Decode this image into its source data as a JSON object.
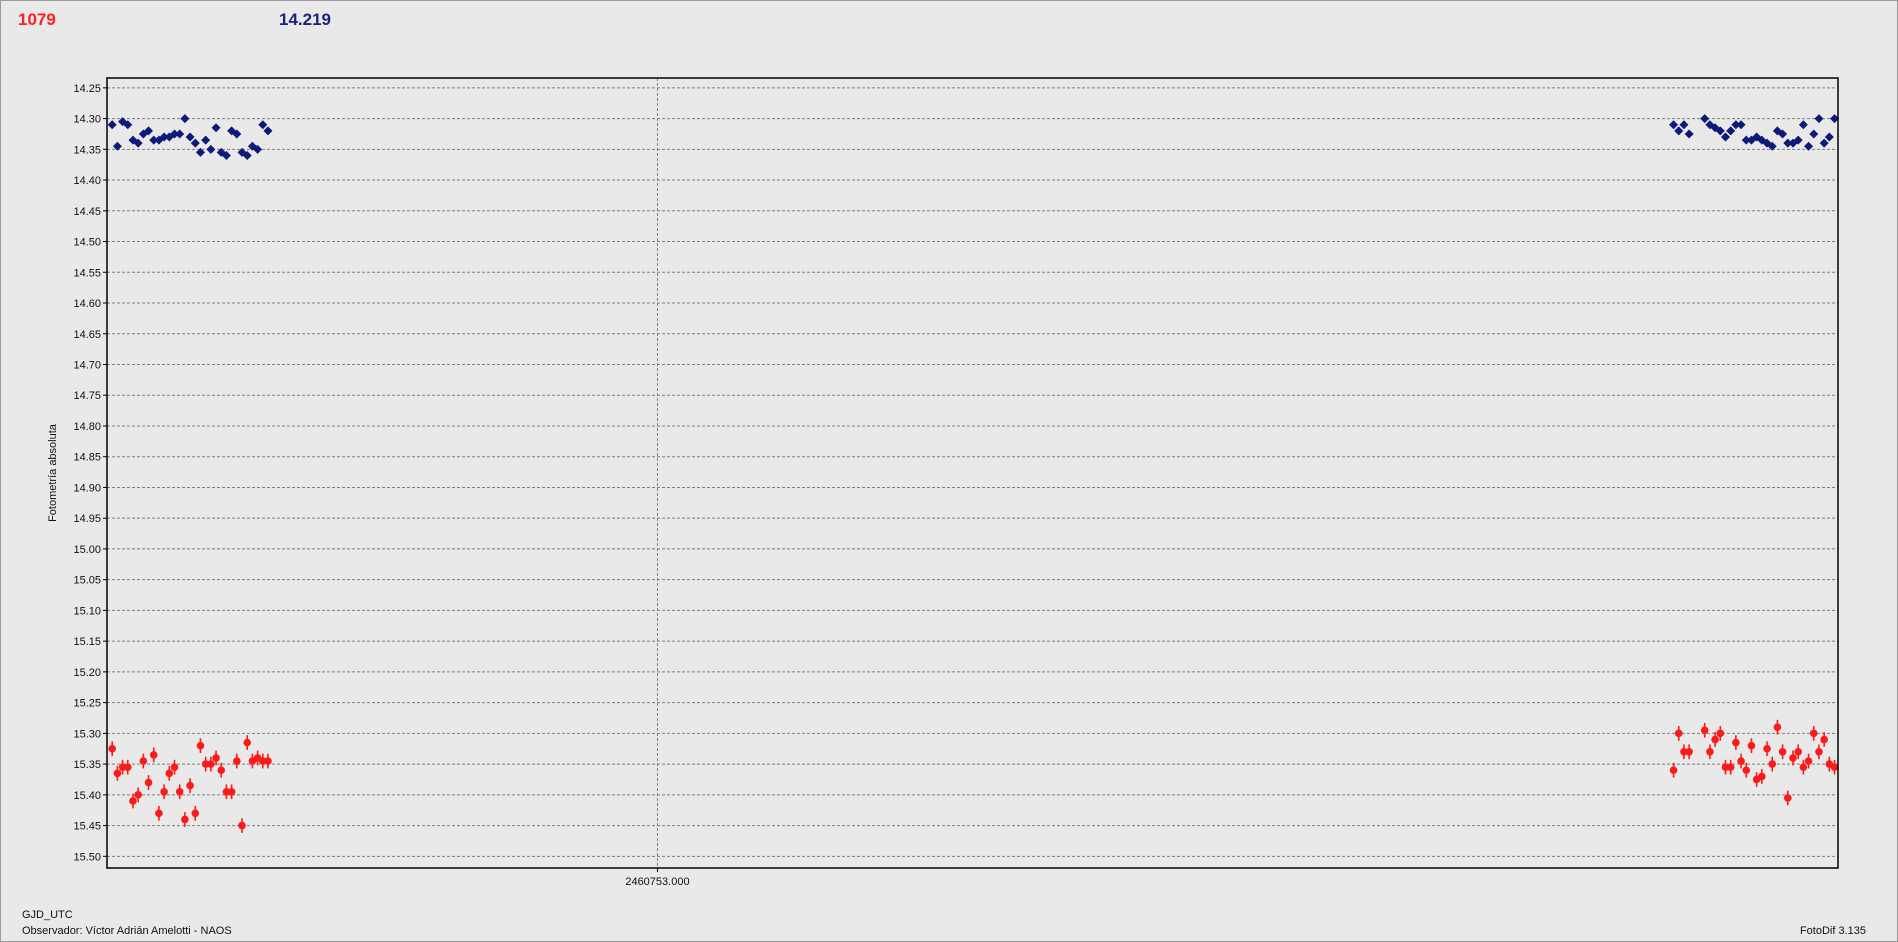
{
  "header": {
    "left_value": "1079",
    "right_value": "14.219"
  },
  "footer": {
    "x_label": "GJD_UTC",
    "observer": "Observador: Víctor Adrián Amelotti - NAOS",
    "software": "FotoDif 3.135"
  },
  "colors": {
    "series_red": "#ff1a1a",
    "series_blue": "#0d1a7a",
    "grid": "#7f7f7f"
  },
  "chart_data": {
    "type": "scatter",
    "ylabel": "Fotometría absoluta",
    "y_inverted": true,
    "ylim": [
      14.234,
      15.519
    ],
    "xlim": [
      0,
      100
    ],
    "grid": true,
    "y_ticks": [
      "14.25",
      "14.30",
      "14.35",
      "14.40",
      "14.45",
      "14.50",
      "14.55",
      "14.60",
      "14.65",
      "14.70",
      "14.75",
      "14.80",
      "14.85",
      "14.90",
      "14.95",
      "15.00",
      "15.05",
      "15.10",
      "15.15",
      "15.20",
      "15.25",
      "15.30",
      "15.35",
      "15.40",
      "15.45",
      "15.50"
    ],
    "x_ticks": [
      {
        "value": 31.8,
        "label": "2460753.000"
      }
    ],
    "series": [
      {
        "color": "#0d1a7a",
        "x": [
          0.3,
          0.6,
          0.9,
          1.2,
          1.5,
          1.8,
          2.1,
          2.4,
          2.7,
          3.0,
          3.3,
          3.6,
          3.9,
          4.2,
          4.5,
          4.8,
          5.1,
          5.4,
          5.7,
          6.0,
          6.3,
          6.6,
          6.9,
          7.2,
          7.5,
          7.8,
          8.1,
          8.4,
          8.7,
          9.0,
          9.3,
          90.5,
          90.8,
          91.1,
          91.4,
          92.3,
          92.6,
          92.9,
          93.2,
          93.5,
          93.8,
          94.1,
          94.4,
          94.7,
          95.0,
          95.3,
          95.6,
          95.9,
          96.2,
          96.5,
          96.8,
          97.1,
          97.4,
          97.7,
          98.0,
          98.3,
          98.6,
          98.9,
          99.2,
          99.5,
          99.8
        ],
        "y": [
          14.31,
          14.345,
          14.305,
          14.31,
          14.335,
          14.34,
          14.325,
          14.32,
          14.335,
          14.335,
          14.33,
          14.33,
          14.325,
          14.325,
          14.3,
          14.33,
          14.34,
          14.355,
          14.335,
          14.35,
          14.315,
          14.355,
          14.36,
          14.32,
          14.325,
          14.355,
          14.36,
          14.345,
          14.35,
          14.31,
          14.32,
          14.31,
          14.32,
          14.31,
          14.325,
          14.3,
          14.31,
          14.315,
          14.32,
          14.33,
          14.32,
          14.31,
          14.31,
          14.335,
          14.335,
          14.33,
          14.335,
          14.34,
          14.345,
          14.32,
          14.325,
          14.34,
          14.34,
          14.335,
          14.31,
          14.345,
          14.325,
          14.3,
          14.34,
          14.33,
          14.3
        ],
        "yerr": [
          0.006,
          0.006,
          0.006,
          0.006,
          0.006,
          0.006,
          0.006,
          0.006,
          0.006,
          0.006,
          0.006,
          0.006,
          0.006,
          0.006,
          0.006,
          0.006,
          0.006,
          0.006,
          0.006,
          0.006,
          0.006,
          0.006,
          0.006,
          0.006,
          0.006,
          0.006,
          0.006,
          0.006,
          0.006,
          0.006,
          0.006,
          0.006,
          0.006,
          0.006,
          0.006,
          0.006,
          0.006,
          0.006,
          0.006,
          0.006,
          0.006,
          0.006,
          0.006,
          0.006,
          0.006,
          0.006,
          0.006,
          0.006,
          0.006,
          0.006,
          0.006,
          0.006,
          0.006,
          0.006,
          0.006,
          0.006,
          0.006,
          0.006,
          0.006,
          0.006,
          0.006
        ]
      },
      {
        "color": "#ff1a1a",
        "x": [
          0.3,
          0.6,
          0.9,
          1.2,
          1.5,
          1.8,
          2.1,
          2.4,
          2.7,
          3.0,
          3.3,
          3.6,
          3.9,
          4.2,
          4.5,
          4.8,
          5.1,
          5.4,
          5.7,
          6.0,
          6.3,
          6.6,
          6.9,
          7.2,
          7.5,
          7.8,
          8.1,
          8.4,
          8.7,
          9.0,
          9.3,
          90.5,
          90.8,
          91.1,
          91.4,
          92.3,
          92.6,
          92.9,
          93.2,
          93.5,
          93.8,
          94.1,
          94.4,
          94.7,
          95.0,
          95.3,
          95.6,
          95.9,
          96.2,
          96.5,
          96.8,
          97.1,
          97.4,
          97.7,
          98.0,
          98.3,
          98.6,
          98.9,
          99.2,
          99.5,
          99.8
        ],
        "y": [
          15.325,
          15.365,
          15.355,
          15.355,
          15.41,
          15.4,
          15.345,
          15.38,
          15.335,
          15.43,
          15.395,
          15.365,
          15.355,
          15.395,
          15.44,
          15.385,
          15.43,
          15.32,
          15.35,
          15.35,
          15.34,
          15.36,
          15.395,
          15.395,
          15.345,
          15.45,
          15.315,
          15.345,
          15.34,
          15.345,
          15.345,
          15.36,
          15.3,
          15.33,
          15.33,
          15.295,
          15.33,
          15.31,
          15.3,
          15.355,
          15.355,
          15.315,
          15.345,
          15.36,
          15.32,
          15.375,
          15.37,
          15.325,
          15.35,
          15.29,
          15.33,
          15.405,
          15.34,
          15.33,
          15.355,
          15.345,
          15.3,
          15.33,
          15.31,
          15.35,
          15.355
        ],
        "yerr": [
          0.012,
          0.012,
          0.012,
          0.012,
          0.012,
          0.012,
          0.012,
          0.012,
          0.012,
          0.012,
          0.012,
          0.012,
          0.012,
          0.012,
          0.012,
          0.012,
          0.012,
          0.012,
          0.012,
          0.012,
          0.012,
          0.012,
          0.012,
          0.012,
          0.012,
          0.012,
          0.012,
          0.012,
          0.012,
          0.012,
          0.012,
          0.012,
          0.012,
          0.012,
          0.012,
          0.012,
          0.012,
          0.012,
          0.012,
          0.012,
          0.012,
          0.012,
          0.012,
          0.012,
          0.012,
          0.012,
          0.012,
          0.012,
          0.012,
          0.012,
          0.012,
          0.012,
          0.012,
          0.012,
          0.012,
          0.012,
          0.012,
          0.012,
          0.012,
          0.012,
          0.012
        ]
      }
    ]
  }
}
